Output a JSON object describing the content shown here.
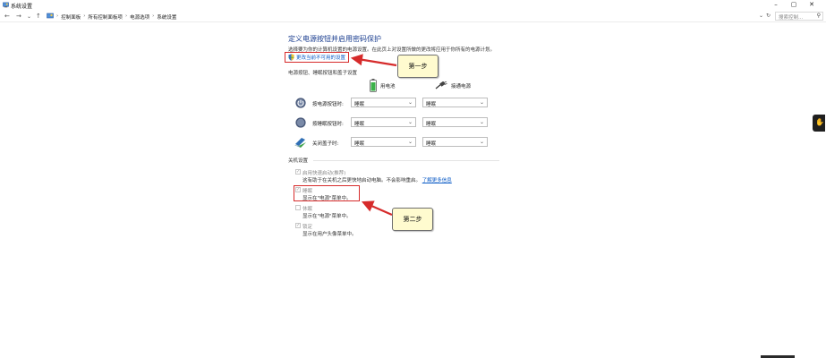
{
  "window": {
    "title": "系统设置",
    "controls": {
      "minimize": "–",
      "maximize": "▢",
      "close": "✕"
    }
  },
  "nav": {
    "back": "←",
    "forward": "→",
    "recent": "⌄",
    "up": "↑"
  },
  "breadcrumbs": [
    "控制面板",
    "所有控制面板项",
    "电源选项",
    "系统设置"
  ],
  "breadcrumb_sep": "›",
  "address_right": {
    "dropdown": "⌄",
    "refresh": "↻"
  },
  "search": {
    "placeholder": "搜索控制...",
    "icon": "search-icon"
  },
  "page": {
    "heading": "定义电源按钮并启用密码保护",
    "description": "选择要为你的计算机设置的电源设置。在此页上对设置所做的更改将应用于你所有的电源计划。",
    "change_link": "更改当前不可用的设置",
    "buttons_section_title": "电源按钮、睡眠按钮和盖子设置",
    "columns": {
      "battery": "用电池",
      "plugged": "接通电源"
    },
    "rows": [
      {
        "label": "按电源按钮时:",
        "icon": "power-icon",
        "battery": "睡眠",
        "plugged": "睡眠"
      },
      {
        "label": "按睡眠按钮时:",
        "icon": "sleep-icon",
        "battery": "睡眠",
        "plugged": "睡眠"
      },
      {
        "label": "关闭盖子时:",
        "icon": "lid-icon",
        "battery": "睡眠",
        "plugged": "睡眠"
      }
    ],
    "shutdown_section_title": "关机设置",
    "shutdown_options": [
      {
        "label": "启用快速启动(推荐)",
        "desc": "这有助于在关机之后更快地启动电脑。不会影响重启。",
        "link": "了解更多信息",
        "checked": true
      },
      {
        "label": "睡眠",
        "desc": "显示在\"电源\"菜单中。",
        "checked": true
      },
      {
        "label": "休眠",
        "desc": "显示在\"电源\"菜单中。",
        "checked": false
      },
      {
        "label": "锁定",
        "desc": "显示在用户头像菜单中。",
        "checked": true
      }
    ]
  },
  "annotations": {
    "step1": "第一步",
    "step2": "第二步"
  },
  "colors": {
    "heading": "#1a3d8f",
    "link": "#0b5bc6",
    "highlight": "#d62b2b",
    "callout_bg": "#fffbcf"
  }
}
